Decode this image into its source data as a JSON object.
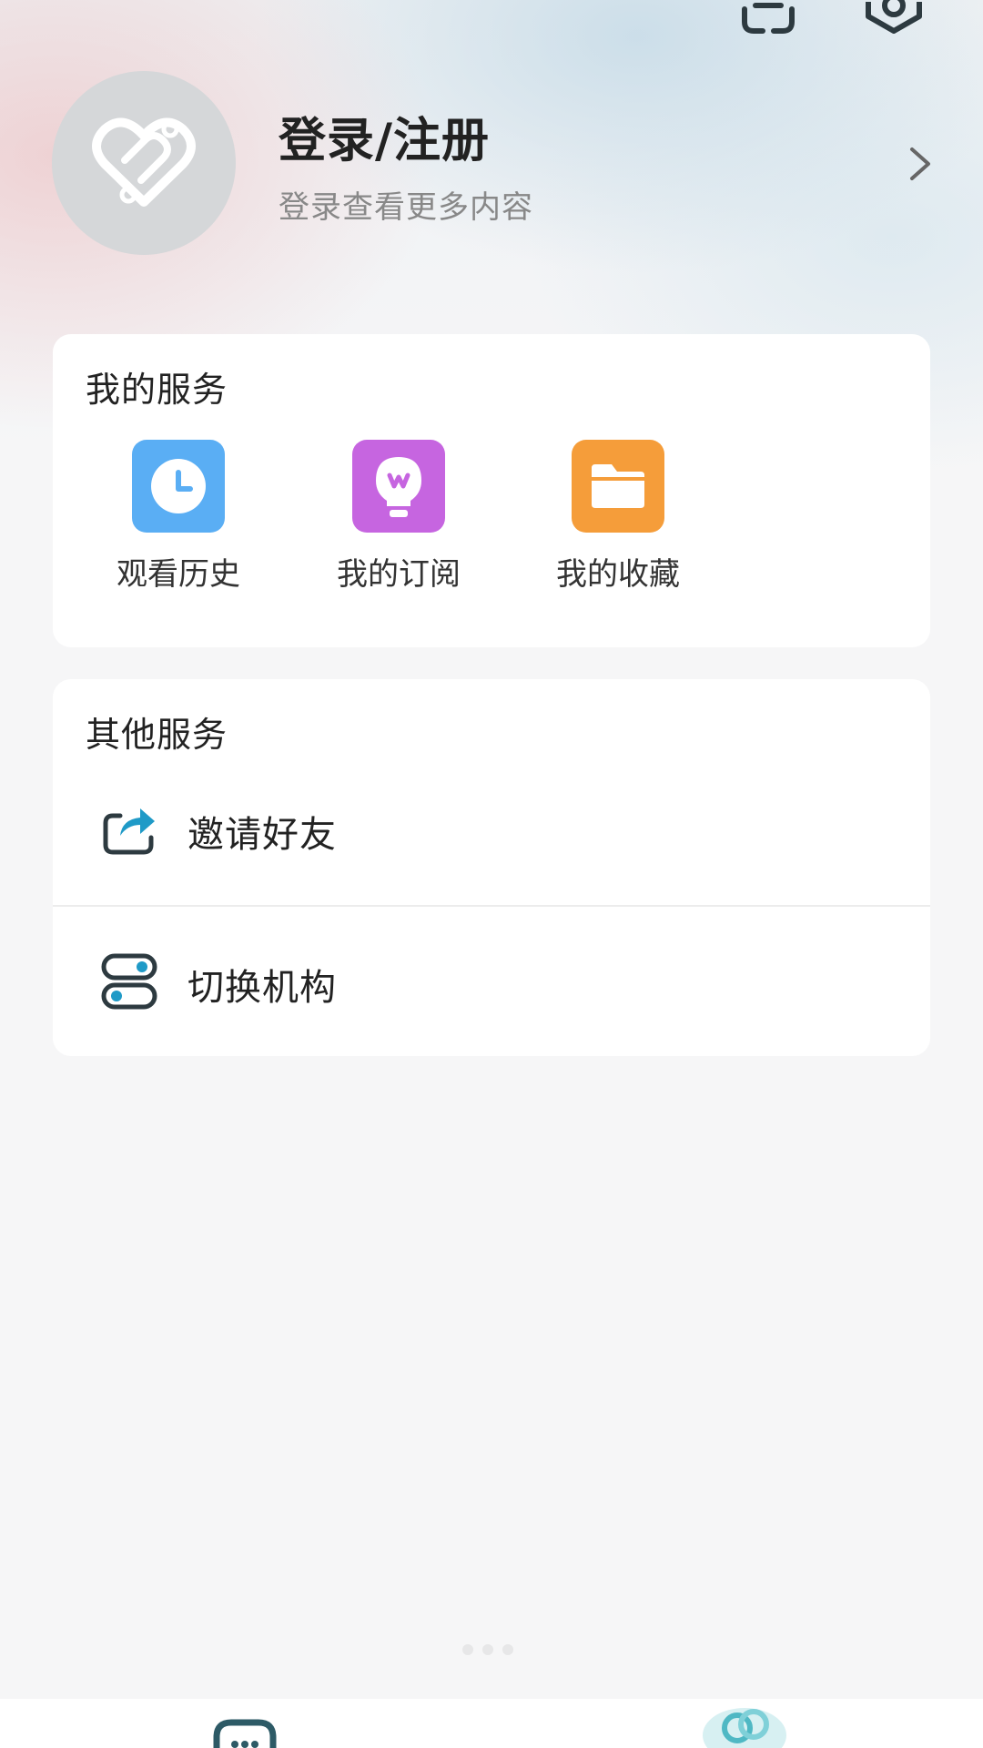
{
  "profile": {
    "title": "登录/注册",
    "subtitle": "登录查看更多内容"
  },
  "my_services": {
    "title": "我的服务",
    "items": [
      {
        "label": "观看历史",
        "icon": "clock-icon",
        "color": "#5aaef4"
      },
      {
        "label": "我的订阅",
        "icon": "lightbulb-icon",
        "color": "#c665e0"
      },
      {
        "label": "我的收藏",
        "icon": "folder-icon",
        "color": "#f59d3a"
      }
    ]
  },
  "other_services": {
    "title": "其他服务",
    "items": [
      {
        "label": "邀请好友",
        "icon": "share-icon"
      },
      {
        "label": "切换机构",
        "icon": "switch-icon"
      }
    ]
  },
  "colors": {
    "accent": "#1f9ac7",
    "icon_dark": "#2d3a40"
  }
}
